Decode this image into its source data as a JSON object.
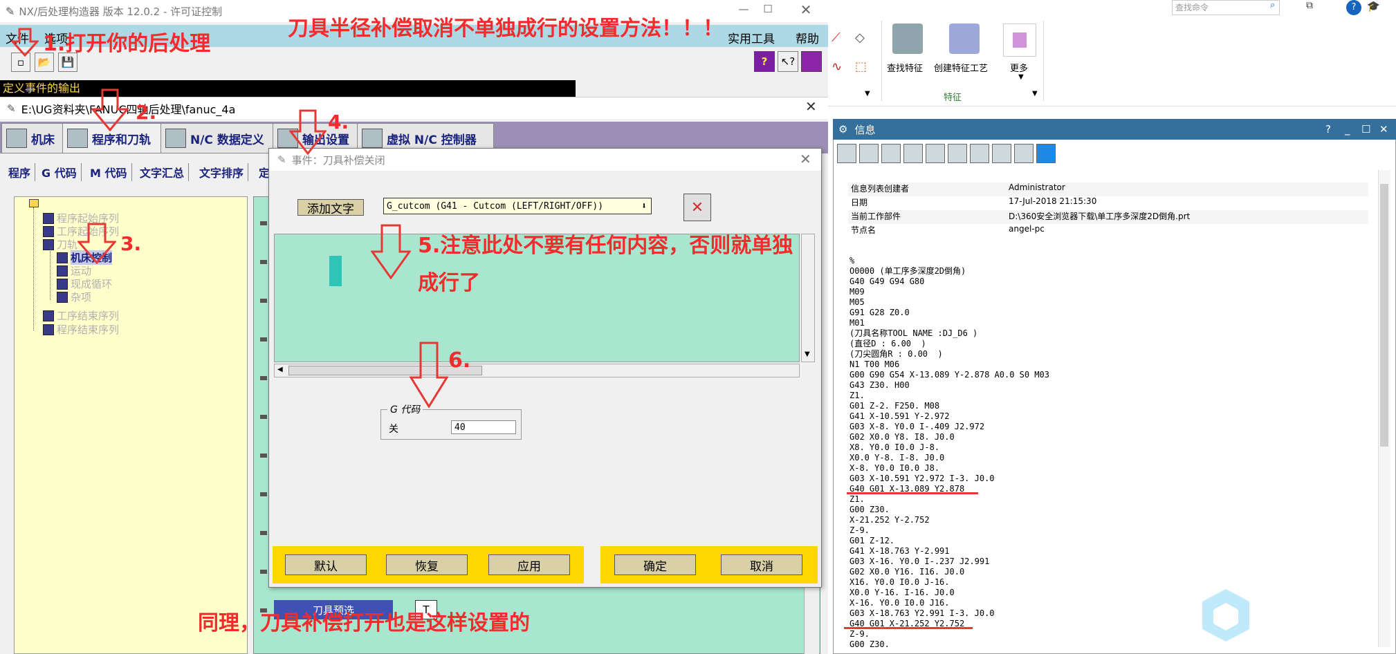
{
  "postbuilder": {
    "title": "NX/后处理构造器 版本 12.0.2 - 许可证控制",
    "menu": {
      "file": "文件",
      "options": "选项",
      "utilities": "实用工具",
      "help": "帮助"
    },
    "event_output_label": "定义事件的输出",
    "path_title": "E:\\UG资料夹\\FANUC四轴后处理\\fanuc_4a",
    "tabs": [
      "机床",
      "程序和刀轨",
      "N/C 数据定义",
      "输出设置",
      "虚拟 N/C 控制器"
    ],
    "subtabs": [
      "程序",
      "G 代码",
      "M 代码",
      "文字汇总",
      "文字排序",
      "定"
    ],
    "tree": [
      "程序起始序列",
      "工序起始序列",
      "刀轨",
      "机床控制",
      "运动",
      "现成循环",
      "杂项",
      "工序结束序列",
      "程序结束序列"
    ],
    "tree_partial_2": "工序起始序列",
    "tool_preselect": "刀具预选",
    "tool_preselect_t": "T"
  },
  "dialog": {
    "title": "事件：刀具补偿关闭",
    "add_text": "添加文字",
    "dropdown_value": "G_cutcom (G41 - Cutcom (LEFT/RIGHT/OFF))",
    "group_label": "G 代码",
    "field_label": "关",
    "field_value": "40",
    "buttons": {
      "default": "默认",
      "restore": "恢复",
      "apply": "应用",
      "ok": "确定",
      "cancel": "取消"
    }
  },
  "nx": {
    "search_placeholder": "查找命令",
    "ribbon": {
      "find_feature": "查找特征",
      "create_feature_process": "创建特征工艺",
      "more": "更多",
      "group": "特征"
    },
    "info_title": "信息",
    "info_table": [
      {
        "k": "信息列表创建者",
        "v": "Administrator"
      },
      {
        "k": "日期",
        "v": "17-Jul-2018 21:15:30"
      },
      {
        "k": "当前工作部件",
        "v": "D:\\360安全浏览器下载\\单工序多深度2D倒角.prt"
      },
      {
        "k": "节点名",
        "v": "angel-pc"
      }
    ],
    "nc_code": [
      "%",
      "O0000 (单工序多深度2D倒角)",
      "G40 G49 G94 G80",
      "M09",
      "M05",
      "G91 G28 Z0.0",
      "M01",
      "(刀具名称TOOL NAME :DJ_D6 )",
      "(直径D : 6.00  )",
      "(刀尖圆角R : 0.00  )",
      "N1 T00 M06",
      "G00 G90 G54 X-13.089 Y-2.878 A0.0 S0 M03",
      "G43 Z30. H00",
      "Z1.",
      "G01 Z-2. F250. M08",
      "G41 X-10.591 Y-2.972",
      "G03 X-8. Y0.0 I-.409 J2.972",
      "G02 X0.0 Y8. I8. J0.0",
      "X8. Y0.0 I0.0 J-8.",
      "X0.0 Y-8. I-8. J0.0",
      "X-8. Y0.0 I0.0 J8.",
      "G03 X-10.591 Y2.972 I-3. J0.0",
      "G40 G01 X-13.089 Y2.878",
      "Z1.",
      "G00 Z30.",
      "X-21.252 Y-2.752",
      "Z-9.",
      "G01 Z-12.",
      "G41 X-18.763 Y-2.991",
      "G03 X-16. Y0.0 I-.237 J2.991",
      "G02 X0.0 Y16. I16. J0.0",
      "X16. Y0.0 I0.0 J-16.",
      "X0.0 Y-16. I-16. J0.0",
      "X-16. Y0.0 I0.0 J16.",
      "G03 X-18.763 Y2.991 I-3. J0.0",
      "G40 G01 X-21.252 Y2.752",
      "Z-9.",
      "G00 Z30."
    ]
  },
  "annotations": {
    "headline": "刀具半径补偿取消不单独成行的设置方法！！！",
    "step1": "1.打开你的后处理",
    "step2": "2.",
    "step3": "3.",
    "step4": "4.",
    "step5a": "5.注意此处不要有任何内容，否则就单独",
    "step5b": "成行了",
    "step6": "6.",
    "footer": "同理，刀具补偿打开也是这样设置的"
  },
  "colors": {
    "annotation_red": "#f22c2c",
    "dialog_green": "#a8e6cf",
    "tree_yellow": "#ffffcc",
    "button_bar_yellow": "#ffd700"
  }
}
